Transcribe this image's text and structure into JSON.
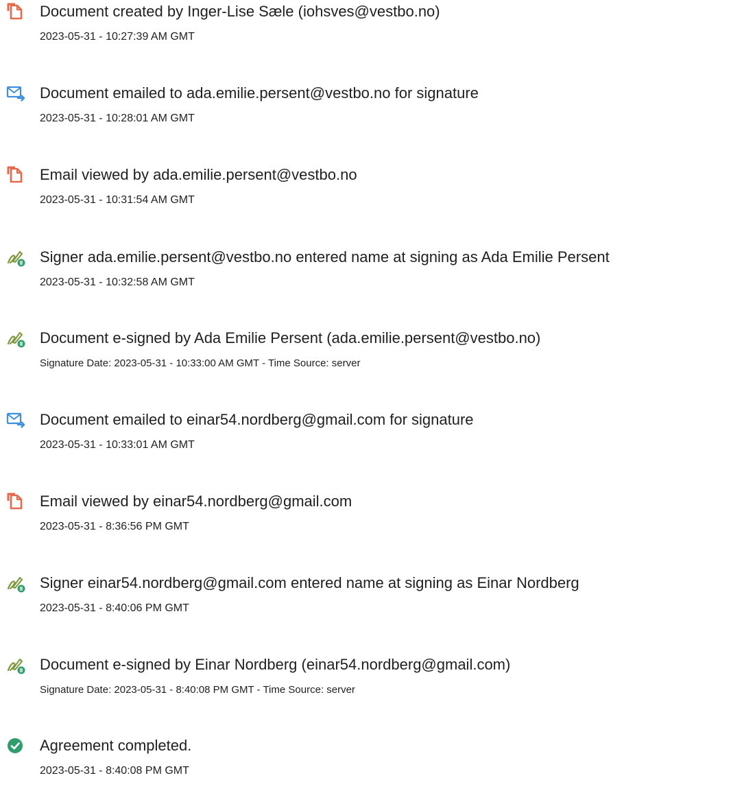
{
  "colors": {
    "doc_icon": "#e8684a",
    "mail_icon": "#3d8fe0",
    "sign_icon": "#7a9a3a",
    "sign_badge": "#2f9e6b",
    "check_icon": "#2f9e6b",
    "text": "#1f1f1f"
  },
  "events": [
    {
      "icon": "document-icon",
      "title": "Document created by Inger-Lise Sæle (iohsves@vestbo.no)",
      "time": "2023-05-31 - 10:27:39 AM GMT"
    },
    {
      "icon": "email-icon",
      "title": "Document emailed to ada.emilie.persent@vestbo.no for signature",
      "time": "2023-05-31 - 10:28:01 AM GMT"
    },
    {
      "icon": "document-icon",
      "title": "Email viewed by ada.emilie.persent@vestbo.no",
      "time": "2023-05-31 - 10:31:54 AM GMT"
    },
    {
      "icon": "signature-icon",
      "title": "Signer ada.emilie.persent@vestbo.no entered name at signing as Ada Emilie Persent",
      "time": "2023-05-31 - 10:32:58 AM GMT"
    },
    {
      "icon": "signature-icon",
      "title": "Document e-signed by Ada Emilie Persent (ada.emilie.persent@vestbo.no)",
      "time": "Signature Date: 2023-05-31 - 10:33:00 AM GMT - Time Source: server"
    },
    {
      "icon": "email-icon",
      "title": "Document emailed to einar54.nordberg@gmail.com for signature",
      "time": "2023-05-31 - 10:33:01 AM GMT"
    },
    {
      "icon": "document-icon",
      "title": "Email viewed by einar54.nordberg@gmail.com",
      "time": "2023-05-31 - 8:36:56 PM GMT"
    },
    {
      "icon": "signature-icon",
      "title": "Signer einar54.nordberg@gmail.com entered name at signing as Einar Nordberg",
      "time": "2023-05-31 - 8:40:06 PM GMT"
    },
    {
      "icon": "signature-icon",
      "title": "Document e-signed by Einar Nordberg (einar54.nordberg@gmail.com)",
      "time": "Signature Date: 2023-05-31 - 8:40:08 PM GMT - Time Source: server"
    },
    {
      "icon": "checkmark-icon",
      "title": "Agreement completed.",
      "time": "2023-05-31 - 8:40:08 PM GMT"
    }
  ]
}
